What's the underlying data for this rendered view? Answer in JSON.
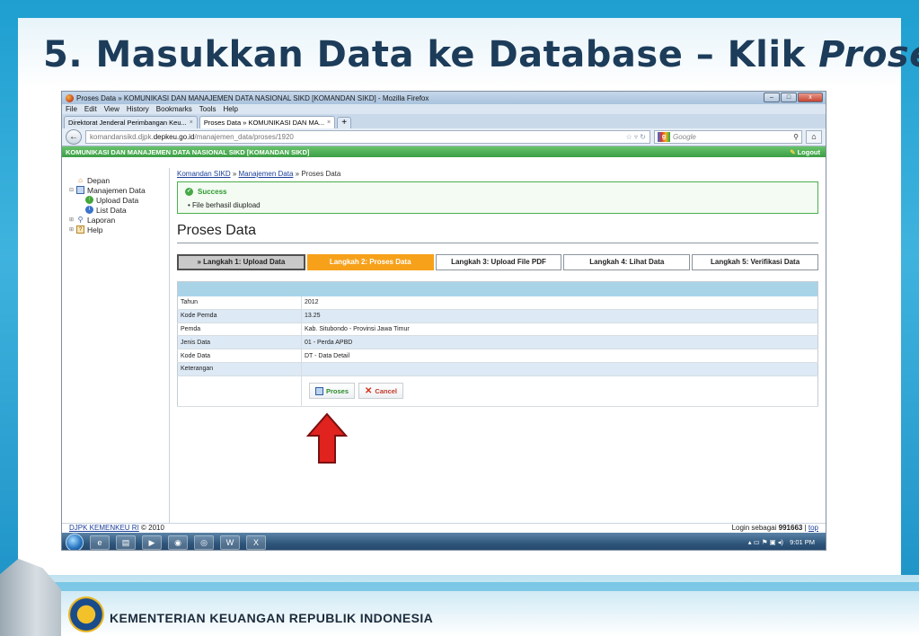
{
  "slide": {
    "title_main": "5. Masukkan Data ke Database – Klik ",
    "title_italic": "Proses",
    "footer_text": "KEMENTERIAN KEUANGAN REPUBLIK INDONESIA"
  },
  "browser": {
    "window_title": "Proses Data » KOMUNIKASI DAN MANAJEMEN DATA NASIONAL SIKD [KOMANDAN SIKD] - Mozilla Firefox",
    "menu": [
      "File",
      "Edit",
      "View",
      "History",
      "Bookmarks",
      "Tools",
      "Help"
    ],
    "tabs": [
      {
        "label": "Direktorat Jenderal Perimbangan Keu..."
      },
      {
        "label": "Proses Data » KOMUNIKASI DAN MA..."
      }
    ],
    "url_prefix": "komandansikd.djpk.",
    "url_host": "depkeu.go.id",
    "url_path": "/manajemen_data/proses/1920",
    "search_placeholder": "Google"
  },
  "app": {
    "header_title": "KOMUNIKASI DAN MANAJEMEN DATA NASIONAL SIKD [KOMANDAN SIKD]",
    "logout": "Logout",
    "sidebar": {
      "depan": "Depan",
      "manajemen_data": "Manajemen Data",
      "upload_data": "Upload Data",
      "list_data": "List Data",
      "laporan": "Laporan",
      "help": "Help"
    },
    "breadcrumb": {
      "root": "Komandan SIKD",
      "section": "Manajemen Data",
      "current": "Proses Data"
    },
    "message": {
      "title": "Success",
      "text": "File berhasil diupload"
    },
    "page_heading": "Proses Data",
    "steps": [
      "» Langkah 1: Upload Data",
      "Langkah 2: Proses Data",
      "Langkah 3: Upload File PDF",
      "Langkah 4: Lihat Data",
      "Langkah 5: Verifikasi Data"
    ],
    "rows": [
      {
        "label": "Tahun",
        "value": "2012"
      },
      {
        "label": "Kode Pemda",
        "value": "13.25"
      },
      {
        "label": "Pemda",
        "value": "Kab. Situbondo - Provinsi Jawa Timur"
      },
      {
        "label": "Jenis Data",
        "value": "01 - Perda APBD"
      },
      {
        "label": "Kode Data",
        "value": "DT - Data Detail"
      },
      {
        "label": "Keterangan",
        "value": ""
      }
    ],
    "buttons": {
      "proses": "Proses",
      "cancel": "Cancel"
    },
    "footer_left": "DJPK KEMENKEU RI",
    "footer_copyright": "© 2010",
    "footer_login_prefix": "Login sebagai",
    "footer_user": "991663",
    "footer_top": "top"
  },
  "taskbar": {
    "time": "9:01 PM"
  },
  "colors": {
    "step_active": "#f7a11a",
    "success_green": "#2f9a2f",
    "header_green": "#3b9e44",
    "arrow_red": "#e0231f"
  }
}
